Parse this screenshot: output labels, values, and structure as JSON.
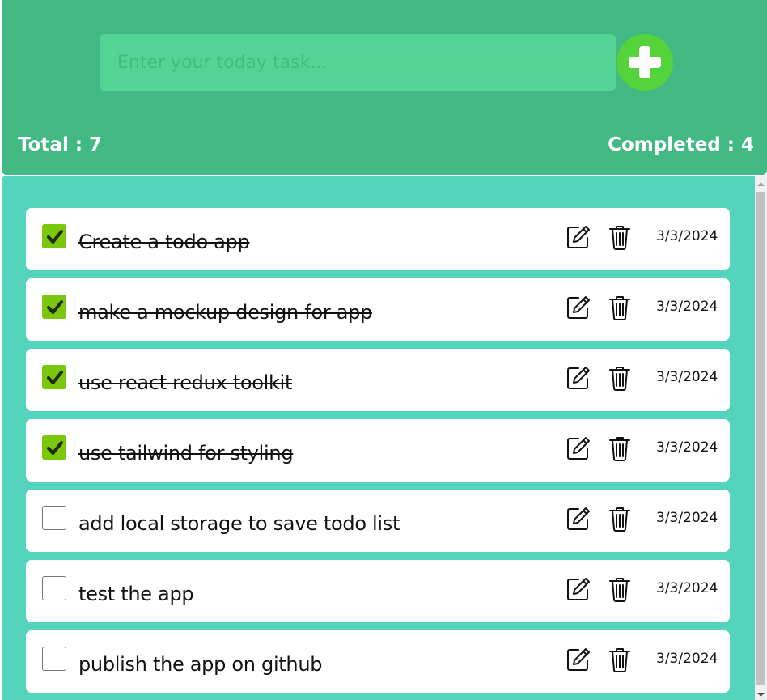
{
  "input": {
    "placeholder": "Enter your today task...",
    "value": ""
  },
  "stats": {
    "total": "Total : 7",
    "completed": "Completed : 4"
  },
  "todos": [
    {
      "text": "Create a todo app",
      "date": "3/3/2024",
      "done": true
    },
    {
      "text": "make a mockup design for app",
      "date": "3/3/2024",
      "done": true
    },
    {
      "text": "use react redux toolkit",
      "date": "3/3/2024",
      "done": true
    },
    {
      "text": "use tailwind for styling",
      "date": "3/3/2024",
      "done": true
    },
    {
      "text": "add local storage to save todo list",
      "date": "3/3/2024",
      "done": false
    },
    {
      "text": "test the app",
      "date": "3/3/2024",
      "done": false
    },
    {
      "text": "publish the app on github",
      "date": "3/3/2024",
      "done": false
    }
  ],
  "icons": {
    "add": "plus-icon",
    "edit": "edit-icon",
    "delete": "trash-icon",
    "check": "checkmark-icon"
  },
  "colors": {
    "header": "#42b883",
    "input_bg": "#55d394",
    "add_button": "#55d33a",
    "list_bg": "#54d3bd",
    "checkbox_checked": "#7ac70c"
  }
}
